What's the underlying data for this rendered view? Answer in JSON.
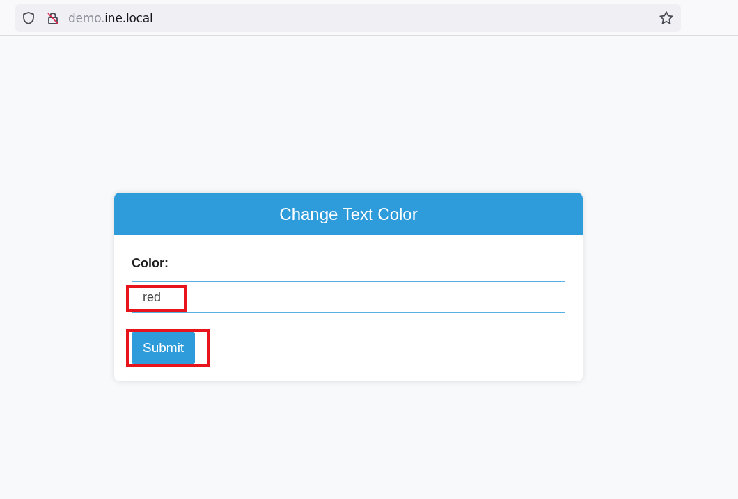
{
  "browser": {
    "url": {
      "subdomain": "demo.",
      "domain": "ine.local"
    }
  },
  "form_card": {
    "title": "Change Text Color",
    "color_field": {
      "label": "Color:",
      "value": "red",
      "focused": true,
      "highlighted": true
    },
    "submit_button": {
      "label": "Submit",
      "highlighted": true
    }
  }
}
